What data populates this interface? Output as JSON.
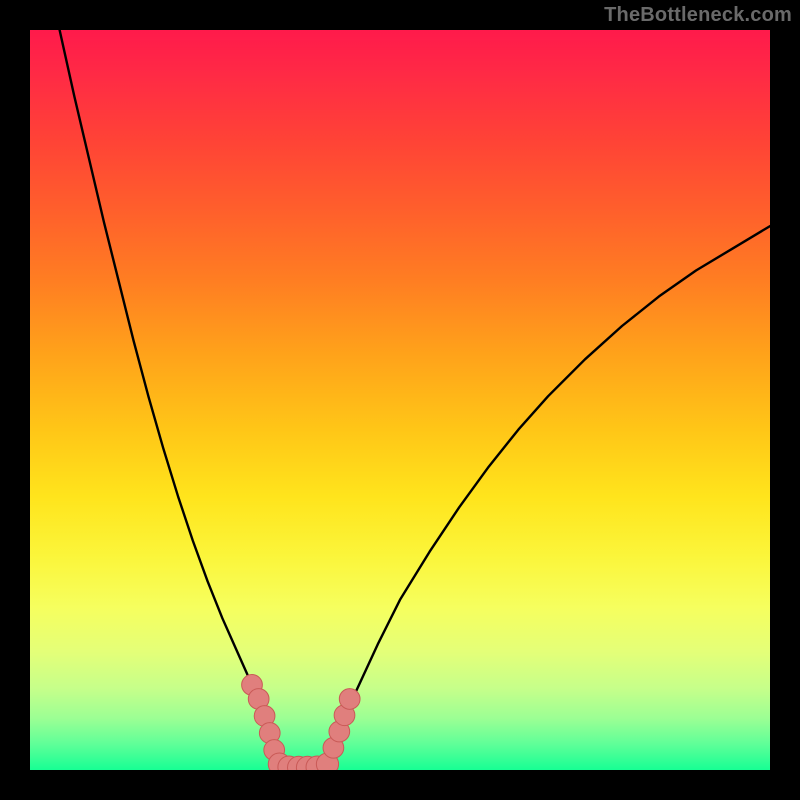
{
  "watermark": "TheBottleneck.com",
  "colors": {
    "background": "#000000",
    "gradient_top": "#ff1a4b",
    "gradient_bottom": "#17ff94",
    "curve": "#000000",
    "marker_fill": "#e07f7d",
    "marker_stroke": "#c95a57"
  },
  "chart_data": {
    "type": "line",
    "title": "",
    "xlabel": "",
    "ylabel": "",
    "xlim": [
      0,
      100
    ],
    "ylim": [
      0,
      100
    ],
    "notes": "V-shaped bottleneck curve over vertical rainbow gradient (red→green). No tick labels visible.",
    "series": [
      {
        "name": "left-branch",
        "x": [
          4,
          6,
          8,
          10,
          12,
          14,
          16,
          18,
          20,
          22,
          24,
          26,
          28,
          30,
          32,
          33.7
        ],
        "y": [
          100,
          91,
          82.5,
          74,
          66,
          58,
          50.5,
          43.5,
          37,
          31,
          25.5,
          20.5,
          16,
          11.5,
          6.5,
          0.5
        ]
      },
      {
        "name": "right-branch",
        "x": [
          40.2,
          42,
          44,
          47,
          50,
          54,
          58,
          62,
          66,
          70,
          75,
          80,
          85,
          90,
          95,
          100
        ],
        "y": [
          0.5,
          5.5,
          10.5,
          17,
          23,
          29.5,
          35.5,
          41,
          46,
          50.5,
          55.5,
          60,
          64,
          67.5,
          70.5,
          73.5
        ]
      },
      {
        "name": "valley-floor",
        "x": [
          33.7,
          35,
          36.5,
          38,
          40.2
        ],
        "y": [
          0.5,
          0.3,
          0.3,
          0.3,
          0.5
        ]
      }
    ],
    "markers": [
      {
        "x": 30.0,
        "y": 11.5,
        "r": 1.4
      },
      {
        "x": 30.9,
        "y": 9.6,
        "r": 1.4
      },
      {
        "x": 31.7,
        "y": 7.3,
        "r": 1.4
      },
      {
        "x": 32.4,
        "y": 5.0,
        "r": 1.4
      },
      {
        "x": 33.0,
        "y": 2.7,
        "r": 1.4
      },
      {
        "x": 33.7,
        "y": 0.8,
        "r": 1.5
      },
      {
        "x": 35.0,
        "y": 0.4,
        "r": 1.5
      },
      {
        "x": 36.3,
        "y": 0.35,
        "r": 1.5
      },
      {
        "x": 37.5,
        "y": 0.35,
        "r": 1.5
      },
      {
        "x": 38.8,
        "y": 0.4,
        "r": 1.5
      },
      {
        "x": 40.2,
        "y": 0.8,
        "r": 1.5
      },
      {
        "x": 41.0,
        "y": 3.0,
        "r": 1.4
      },
      {
        "x": 41.8,
        "y": 5.2,
        "r": 1.4
      },
      {
        "x": 42.5,
        "y": 7.4,
        "r": 1.4
      },
      {
        "x": 43.2,
        "y": 9.6,
        "r": 1.4
      }
    ]
  }
}
